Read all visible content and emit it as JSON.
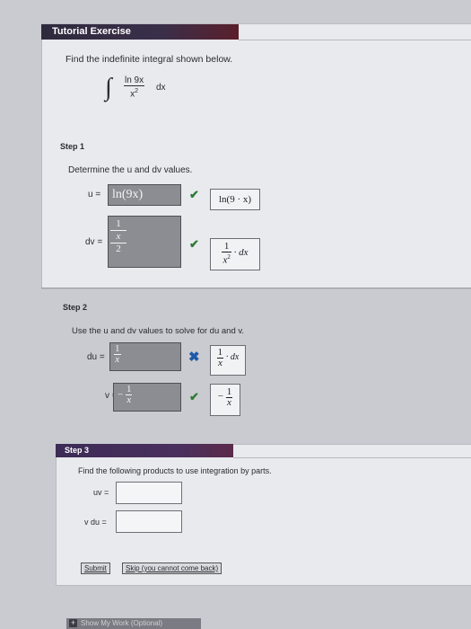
{
  "header": {
    "title": "Tutorial Exercise"
  },
  "problem": {
    "prompt": "Find the indefinite integral shown below.",
    "integral_sign": "∫",
    "numerator": "ln 9x",
    "denominator": "x",
    "denominator_exp": "2",
    "differential": "dx"
  },
  "step1": {
    "label": "Step 1",
    "instruction": "Determine the u and dv values.",
    "u_label": "u =",
    "u_input": "ln(9x)",
    "u_answer": "ln(9 · x)",
    "dv_label": "dv =",
    "dv_input_num": "1",
    "dv_input_mid": "x",
    "dv_input_den": "2",
    "dv_answer_num": "1",
    "dv_answer_den": "x",
    "dv_answer_den_exp": "2",
    "dv_answer_suffix": "· dx"
  },
  "step2": {
    "label": "Step 2",
    "instruction": "Use the u and dv values to solve for du and v.",
    "du_label": "du =",
    "du_input_num": "1",
    "du_input_den": "x",
    "du_answer_num": "1",
    "du_answer_den": "x",
    "du_answer_suffix": "· dx",
    "v_label": "v =",
    "v_input_sign": "−",
    "v_input_num": "1",
    "v_input_den": "x",
    "v_answer_sign": "−",
    "v_answer_num": "1",
    "v_answer_den": "x"
  },
  "step3": {
    "label": "Step 3",
    "instruction": "Find the following products to use integration by parts.",
    "uv_label": "uv =",
    "vdu_label": "v du =",
    "uv_value": "",
    "vdu_value": ""
  },
  "buttons": {
    "submit": "Submit",
    "skip": "Skip (you cannot come back)"
  },
  "footer": {
    "text": "Show My Work (Optional)"
  },
  "colors": {
    "check": "#2f7a35",
    "cross": "#1f5aa8",
    "header_bg": "#2e2a3c",
    "header_accent": "#5a1f2a"
  }
}
